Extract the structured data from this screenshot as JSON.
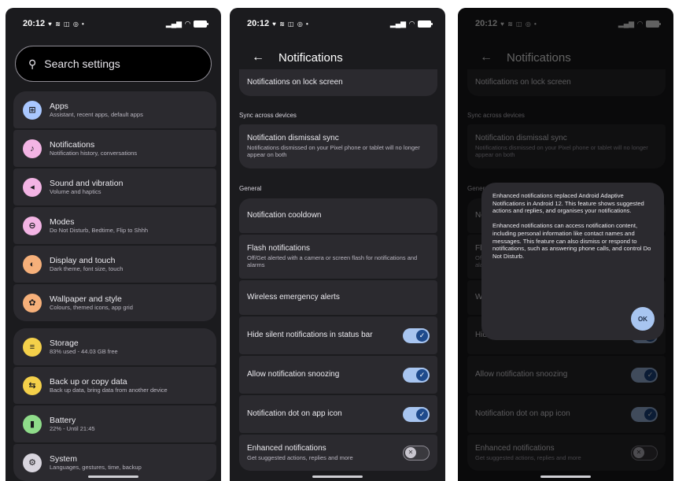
{
  "status": {
    "time": "20:12",
    "icons": "♥ ≋ ◫ ◎ •"
  },
  "screen1": {
    "search_placeholder": "Search settings",
    "group1": [
      {
        "title": "Apps",
        "subtitle": "Assistant, recent apps, default apps",
        "icon": "apps-grid-icon",
        "color": "#a9c7ff"
      },
      {
        "title": "Notifications",
        "subtitle": "Notification history, conversations",
        "icon": "bell-icon",
        "color": "#f3b4e4"
      },
      {
        "title": "Sound and vibration",
        "subtitle": "Volume and haptics",
        "icon": "speaker-icon",
        "color": "#f3b4e4"
      },
      {
        "title": "Modes",
        "subtitle": "Do Not Disturb, Bedtime, Flip to Shhh",
        "icon": "do-not-disturb-icon",
        "color": "#f3b4e4"
      },
      {
        "title": "Display and touch",
        "subtitle": "Dark theme, font size, touch",
        "icon": "brightness-icon",
        "color": "#f6b07a"
      },
      {
        "title": "Wallpaper and style",
        "subtitle": "Colours, themed icons, app grid",
        "icon": "palette-icon",
        "color": "#f6b07a"
      }
    ],
    "group2": [
      {
        "title": "Storage",
        "subtitle": "83% used - 44.03 GB free",
        "icon": "storage-icon",
        "color": "#f4d04a"
      },
      {
        "title": "Back up or copy data",
        "subtitle": "Back up data, bring data from another device",
        "icon": "backup-icon",
        "color": "#f4d04a"
      },
      {
        "title": "Battery",
        "subtitle": "22% - Until 21:45",
        "icon": "battery-icon",
        "color": "#8fdc8a"
      },
      {
        "title": "System",
        "subtitle": "Languages, gestures, time, backup",
        "icon": "gear-icon",
        "color": "#d8d5de"
      }
    ]
  },
  "screen2": {
    "title": "Notifications",
    "lock_screen": "Notifications on lock screen",
    "sync_header": "Sync across devices",
    "dismissal_sync_title": "Notification dismissal sync",
    "dismissal_sync_sub": "Notifications dismissed on your Pixel phone or tablet will no longer appear on both",
    "general_header": "General",
    "cooldown": "Notification cooldown",
    "flash_title": "Flash notifications",
    "flash_sub": "Off/Get alerted with a camera or screen flash for notifications and alarms",
    "wireless": "Wireless emergency alerts",
    "hide_silent": "Hide silent notifications in status bar",
    "snoozing": "Allow notification snoozing",
    "dot": "Notification dot on app icon",
    "enhanced_title": "Enhanced notifications",
    "enhanced_sub": "Get suggested actions, replies and more",
    "toggles": {
      "hide_silent": true,
      "snoozing": true,
      "dot": true,
      "enhanced": false
    }
  },
  "dialog": {
    "para1": "Enhanced notifications replaced Android Adaptive Notifications in Android 12. This feature shows suggested actions and replies, and organises your notifications.",
    "para2": "Enhanced notifications can access notification content, including personal information like contact names and messages. This feature can also dismiss or respond to notifications, such as answering phone calls, and control Do Not Disturb.",
    "ok": "OK"
  }
}
